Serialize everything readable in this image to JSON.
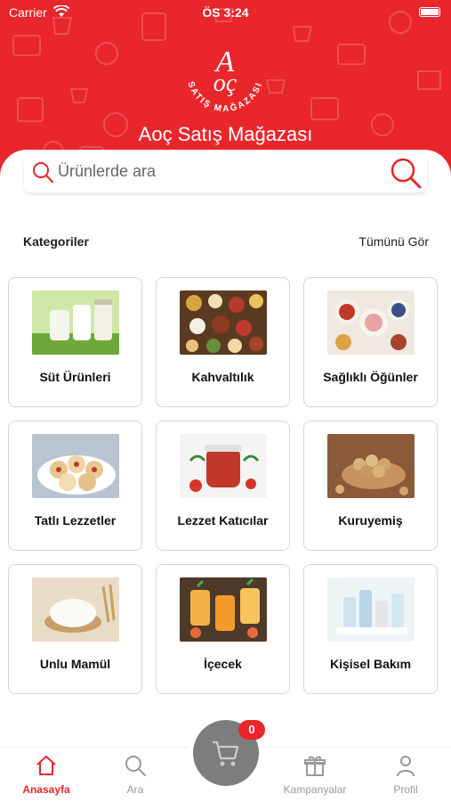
{
  "status_bar": {
    "carrier": "Carrier",
    "time": "ÖS 3:24"
  },
  "header": {
    "logo_text": "AOÇ",
    "logo_arc_text": "SATIŞ MAĞAZASI",
    "title": "Aoç Satış Mağazası",
    "brand_color": "#e8262b"
  },
  "search": {
    "placeholder": "Ürünlerde ara",
    "icon": "search-icon"
  },
  "categories": {
    "title": "Kategoriler",
    "see_all": "Tümünü Gör",
    "items": [
      {
        "label": "Süt Ürünleri",
        "image": "milk-bottles"
      },
      {
        "label": "Kahvaltılık",
        "image": "breakfast-spread"
      },
      {
        "label": "Sağlıklı Öğünler",
        "image": "healthy-bowls"
      },
      {
        "label": "Tatlı Lezzetler",
        "image": "cookies-plate"
      },
      {
        "label": "Lezzet Katıcılar",
        "image": "jam-jar"
      },
      {
        "label": "Kuruyemiş",
        "image": "nuts-bowl"
      },
      {
        "label": "Unlu Mamül",
        "image": "flour-bowl"
      },
      {
        "label": "İçecek",
        "image": "drinks-glasses"
      },
      {
        "label": "Kişisel Bakım",
        "image": "personal-care-bottles"
      }
    ]
  },
  "tabbar": {
    "tabs": [
      {
        "label": "Anasayfa",
        "icon": "home-icon",
        "active": true
      },
      {
        "label": "Ara",
        "icon": "search-icon",
        "active": false
      },
      {
        "label": "Kampanyalar",
        "icon": "gift-icon",
        "active": false
      },
      {
        "label": "Profil",
        "icon": "user-icon",
        "active": false
      }
    ],
    "cart": {
      "icon": "cart-icon",
      "count": "0"
    }
  }
}
